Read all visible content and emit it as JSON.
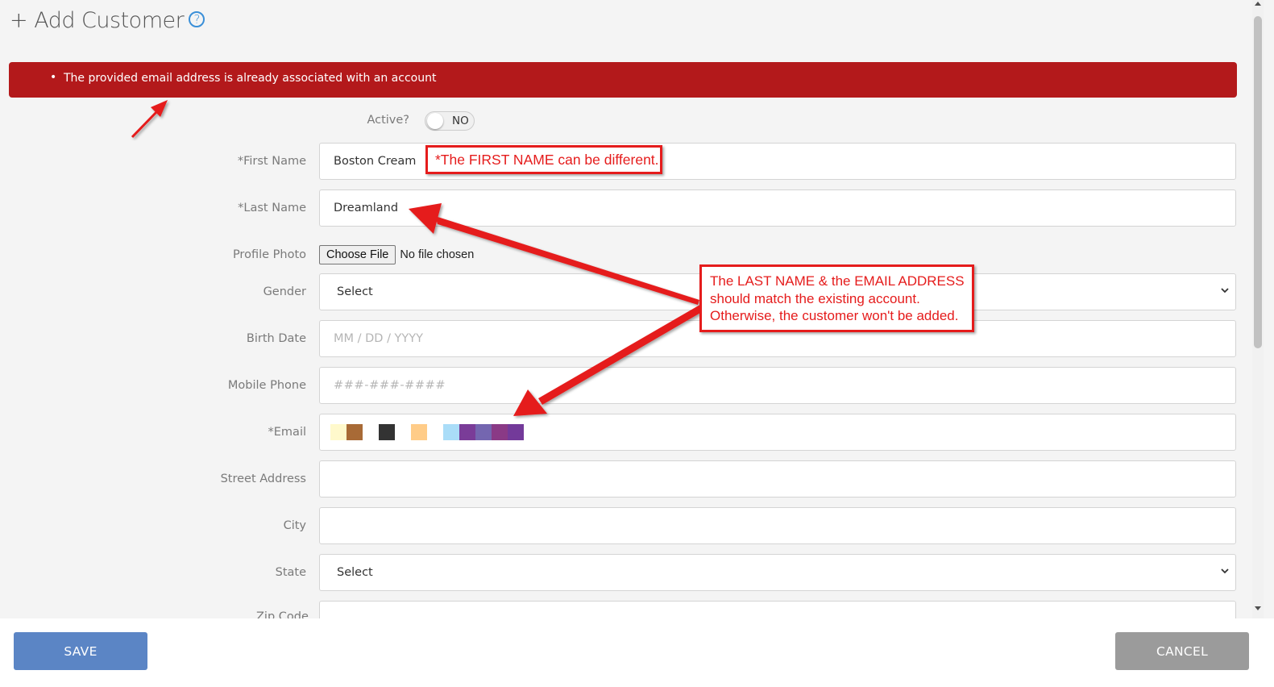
{
  "header": {
    "title": "+ Add Customer",
    "help_icon": "question-circle-icon"
  },
  "alert": {
    "message": "The provided email address is already associated with an account",
    "bullet": "•"
  },
  "form": {
    "active": {
      "label": "Active?",
      "toggle_text": "NO"
    },
    "first_name": {
      "label": "*First Name",
      "value": "Boston Cream"
    },
    "last_name": {
      "label": "*Last Name",
      "value": "Dreamland"
    },
    "profile_photo": {
      "label": "Profile Photo",
      "button": "Choose File",
      "status": "No file chosen"
    },
    "gender": {
      "label": "Gender",
      "selected": "Select"
    },
    "birth_date": {
      "label": "Birth Date",
      "placeholder": "MM / DD / YYYY"
    },
    "mobile_phone": {
      "label": "Mobile Phone",
      "placeholder": "###-###-####"
    },
    "email": {
      "label": "*Email",
      "redacted": true,
      "redaction_colors": [
        "#fff9cc",
        "#a86a36",
        "#f4f4f4",
        "#333333",
        "#f4f4f4",
        "#ffcc88",
        "#f4f4f4",
        "#aaddf8",
        "#7a3c98",
        "#7466b0",
        "#8a3a86",
        "#733a9a"
      ]
    },
    "street_address": {
      "label": "Street Address",
      "value": ""
    },
    "city": {
      "label": "City",
      "value": ""
    },
    "state": {
      "label": "State",
      "selected": "Select"
    },
    "zip_code": {
      "label": "Zip Code"
    }
  },
  "annotations": {
    "callout_first_name": "*The FIRST NAME can be different.",
    "callout_match": [
      "The LAST NAME & the EMAIL ADDRESS",
      "should match the existing account.",
      "Otherwise, the customer won't be added."
    ]
  },
  "footer": {
    "save_label": "SAVE",
    "cancel_label": "CANCEL"
  },
  "colors": {
    "alert_bg": "#b3191b",
    "save_bg": "#5b85c5",
    "cancel_bg": "#9b9b9b",
    "annotation_red": "#e51c1c"
  }
}
